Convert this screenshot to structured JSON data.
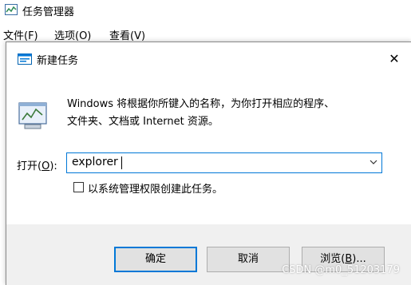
{
  "task_manager": {
    "title": "任务管理器",
    "menu": [
      "文件(F)",
      "选项(O)",
      "查看(V)"
    ]
  },
  "run_dialog": {
    "title": "新建任务",
    "description_line1": "Windows 将根据你所键入的名称，为你打开相应的程序、",
    "description_line2": "文件夹、文档或 Internet 资源。",
    "open_label_prefix": "打开(",
    "open_label_key": "O",
    "open_label_suffix": "):",
    "input_value": "explorer",
    "admin_checkbox_label": "以系统管理权限创建此任务。",
    "admin_checkbox_checked": false,
    "buttons": {
      "ok": "确定",
      "cancel": "取消",
      "browse_prefix": "浏览(",
      "browse_key": "B",
      "browse_suffix": ")..."
    }
  },
  "watermark": "CSDN @m0_51203179",
  "colors": {
    "accent": "#0078d7",
    "footer_bg": "#f0f0f0",
    "button_bg": "#e1e1e1"
  }
}
